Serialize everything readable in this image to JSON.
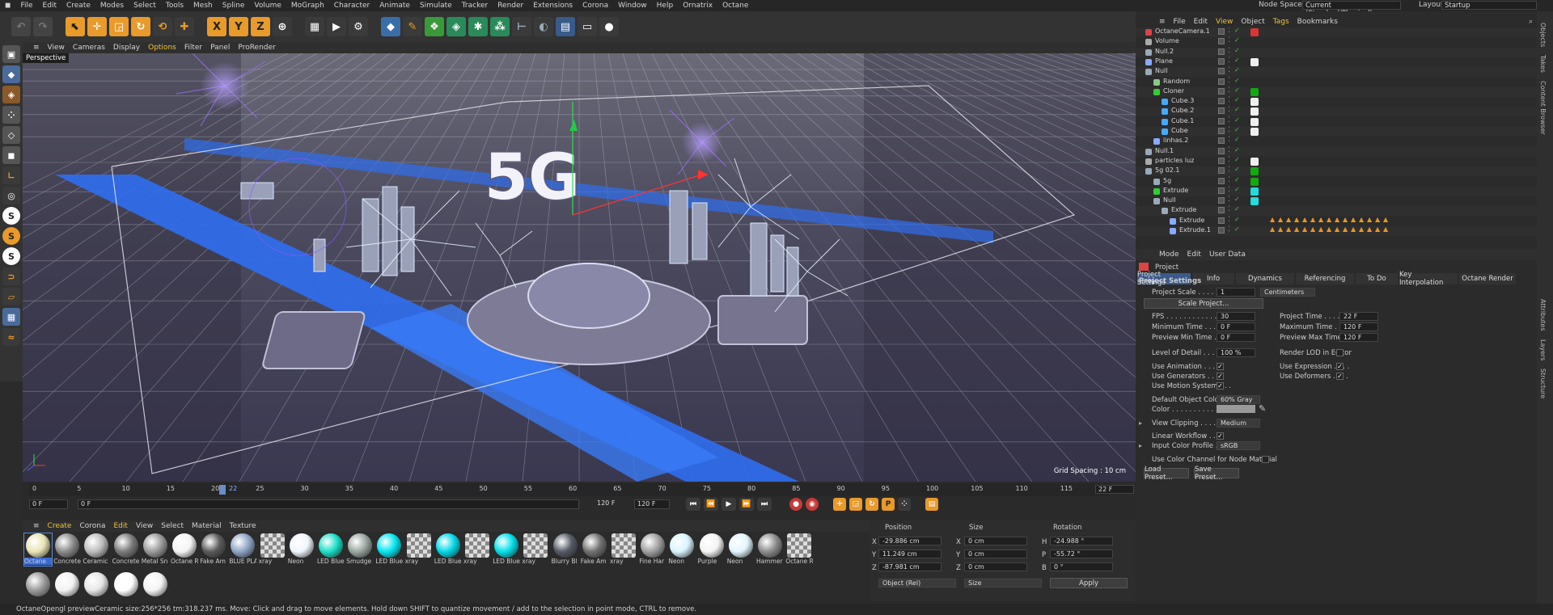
{
  "menu": [
    "File",
    "Edit",
    "Create",
    "Modes",
    "Select",
    "Tools",
    "Mesh",
    "Spline",
    "Volume",
    "MoGraph",
    "Character",
    "Animate",
    "Simulate",
    "Tracker",
    "Render",
    "Extensions",
    "Corona",
    "Window",
    "Help",
    "Ornatrix",
    "Octane"
  ],
  "nodespace_label": "Node Space:",
  "nodespace_value": "Current (Standard/Physical)",
  "layout_label": "Layout:",
  "layout_value": "Startup",
  "viewport_menu": [
    "View",
    "Cameras",
    "Display",
    "Options",
    "Filter",
    "Panel",
    "ProRender"
  ],
  "viewport_label": "Perspective",
  "grid_spacing": "Grid Spacing : 10 cm",
  "title_text": "5G",
  "timeline": {
    "ticks": [
      "0",
      "5",
      "10",
      "15",
      "20",
      "22",
      "25",
      "30",
      "35",
      "40",
      "45",
      "50",
      "55",
      "60",
      "65",
      "70",
      "75",
      "80",
      "85",
      "90",
      "95",
      "100",
      "105",
      "110",
      "115",
      "120"
    ],
    "current_frame": "22 F",
    "start": "0 F",
    "start2": "0 F",
    "end": "120 F",
    "end2": "120 F"
  },
  "material_menu": [
    "Create",
    "Corona",
    "Edit",
    "View",
    "Select",
    "Material",
    "Texture"
  ],
  "materials": [
    {
      "name": "Octane",
      "color": "#e9e4b6"
    },
    {
      "name": "Concrete",
      "color": "#8a8a8a"
    },
    {
      "name": "Ceramic",
      "color": "#bdbdbd"
    },
    {
      "name": "Concrete",
      "color": "#7a7a7a"
    },
    {
      "name": "Metal Sn",
      "color": "#9a9a9a"
    },
    {
      "name": "Octane R",
      "color": "#f4f4f4"
    },
    {
      "name": "Fake Am",
      "color": "#5a5a5a"
    },
    {
      "name": "BLUE PLA",
      "color": "#8ea4c6"
    },
    {
      "name": "xray",
      "color": "checker"
    },
    {
      "name": "Neon",
      "color": "#f0f6ff"
    },
    {
      "name": "LED Blue",
      "color": "#19e0c8"
    },
    {
      "name": "Smudge",
      "color": "#9aa6a0"
    },
    {
      "name": "LED Blue",
      "color": "#00e6f0"
    },
    {
      "name": "xray",
      "color": "checker"
    },
    {
      "name": "LED Blue",
      "color": "#00d8e8"
    },
    {
      "name": "xray",
      "color": "checker"
    },
    {
      "name": "LED Blue",
      "color": "#00e0ea"
    },
    {
      "name": "xray",
      "color": "checker"
    },
    {
      "name": "Blurry Bl",
      "color": "#555a66"
    },
    {
      "name": "Fake Am",
      "color": "#707070"
    },
    {
      "name": "xray",
      "color": "checker"
    },
    {
      "name": "Fine Har",
      "color": "#a0a0a0"
    },
    {
      "name": "Neon",
      "color": "#d8f4ff"
    },
    {
      "name": "Purple",
      "color": "#f4f4f4"
    },
    {
      "name": "Neon",
      "color": "#e2f6ff"
    },
    {
      "name": "Hammer",
      "color": "#8c8c8c"
    },
    {
      "name": "Octane R",
      "color": "checker"
    }
  ],
  "materials_row2": [
    "#9a9a9a",
    "#f2f2f2",
    "#e6e6e6",
    "#ffffff",
    "#f4f4f4"
  ],
  "coords": {
    "position_label": "Position",
    "size_label": "Size",
    "rotation_label": "Rotation",
    "x": "-29.886 cm",
    "y": "11.249 cm",
    "z": "-87.981 cm",
    "sx": "0 cm",
    "sy": "0 cm",
    "sz": "0 cm",
    "h": "-24.988 °",
    "p": "-55.72 °",
    "b": "0 °",
    "mode": "Object (Rel)",
    "size_mode": "Size",
    "apply": "Apply"
  },
  "status": "OctaneOpengl previewCeramic  size:256*256  tm:318.237 ms.     Move: Click and drag to move elements. Hold down SHIFT to quantize movement / add to the selection in point mode, CTRL to remove.",
  "objects_menu": [
    "File",
    "Edit",
    "View",
    "Object",
    "Tags",
    "Bookmarks"
  ],
  "objects": [
    {
      "name": "OctaneCamera.1",
      "indent": 0
    },
    {
      "name": "Volume",
      "indent": 0
    },
    {
      "name": "Null.2",
      "indent": 0
    },
    {
      "name": "Plane",
      "indent": 0
    },
    {
      "name": "Null",
      "indent": 0
    },
    {
      "name": "Random",
      "indent": 1
    },
    {
      "name": "Cloner",
      "indent": 1
    },
    {
      "name": "Cube.3",
      "indent": 2
    },
    {
      "name": "Cube.2",
      "indent": 2
    },
    {
      "name": "Cube.1",
      "indent": 2
    },
    {
      "name": "Cube",
      "indent": 2
    },
    {
      "name": "linhas.2",
      "indent": 1
    },
    {
      "name": "Null.1",
      "indent": 0
    },
    {
      "name": "particles luz",
      "indent": 0
    },
    {
      "name": "5g 02.1",
      "indent": 0
    },
    {
      "name": "5g",
      "indent": 1
    },
    {
      "name": "Extrude",
      "indent": 1
    },
    {
      "name": "Null",
      "indent": 1
    },
    {
      "name": "Extrude",
      "indent": 2
    },
    {
      "name": "Extrude",
      "indent": 3
    },
    {
      "name": "Extrude.1",
      "indent": 3
    }
  ],
  "side_tabs_top": [
    "Objects",
    "Takes",
    "Content Browser"
  ],
  "side_tabs_bottom": [
    "Attributes",
    "Layers",
    "Structure"
  ],
  "attr_menu": [
    "Mode",
    "Edit",
    "User Data"
  ],
  "attr_title": "Project",
  "attr_tabs": [
    "Project Settings",
    "Info",
    "Dynamics",
    "Referencing",
    "To Do",
    "Key Interpolation",
    "Octane Render"
  ],
  "section_title": "Project Settings",
  "project_scale_label": "Project Scale . . . . .",
  "project_scale_value": "1",
  "project_scale_unit": "Centimeters",
  "scale_project_btn": "Scale Project...",
  "fields_left": [
    {
      "label": "FPS . . . . . . . . . . . . .",
      "value": "30"
    },
    {
      "label": "Minimum Time . . . . .",
      "value": "0 F"
    },
    {
      "label": "Preview Min Time . . .",
      "value": "0 F"
    }
  ],
  "fields_right": [
    {
      "label": "Project Time . . . . . .",
      "value": "22 F"
    },
    {
      "label": "Maximum Time . . . . .",
      "value": "120 F"
    },
    {
      "label": "Preview Max Time . . .",
      "value": "120 F"
    }
  ],
  "lod_label": "Level of Detail . . . . .",
  "lod_value": "100 %",
  "render_lod_label": "Render LOD in Editor",
  "use_animation": "Use Animation . . . . .",
  "use_expression": "Use Expression . . . .",
  "use_generators": "Use Generators . . . .",
  "use_deformers": "Use Deformers . . . .",
  "use_motion": "Use Motion System . . .",
  "default_color_label": "Default Object Color",
  "default_color_value": "60% Gray",
  "color_label": "Color . . . . . . . . . . .",
  "view_clipping_label": "View Clipping . . . . . .",
  "view_clipping_value": "Medium",
  "linear_workflow_label": "Linear Workflow . . . .",
  "input_profile_label": "Input Color Profile . . .",
  "input_profile_value": "sRGB",
  "color_channel_label": "Use Color Channel for Node Material",
  "load_preset": "Load Preset...",
  "save_preset": "Save Preset..."
}
